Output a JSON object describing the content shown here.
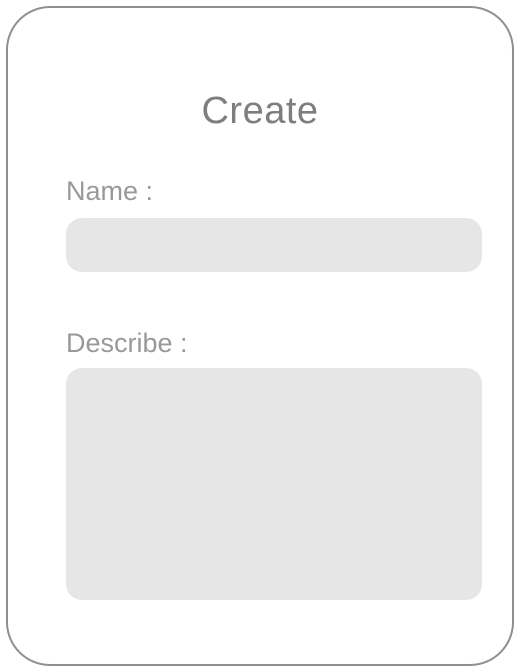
{
  "form": {
    "title": "Create",
    "name_label": "Name :",
    "name_value": "",
    "name_placeholder": "",
    "describe_label": "Describe :",
    "describe_value": "",
    "describe_placeholder": ""
  },
  "colors": {
    "card_border": "#8f8f8f",
    "title_text": "#7e7e7e",
    "label_text": "#999999",
    "field_background": "#e6e6e6"
  }
}
